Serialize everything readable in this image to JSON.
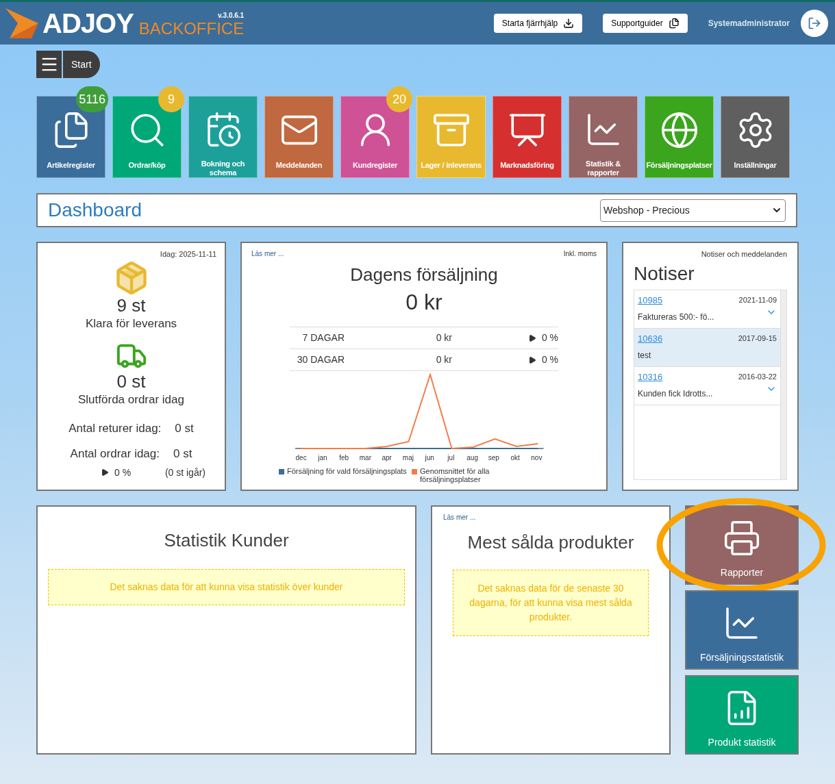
{
  "header": {
    "brand": "ADJOY",
    "product": "BACKOFFICE",
    "version": "v.3.0.6.1",
    "buttons": [
      "Starta fjärrhjälp",
      "Supportguider"
    ],
    "user": "Systemadministrator"
  },
  "nav": {
    "start": "Start"
  },
  "tiles": [
    {
      "label": "Artikelregister",
      "color": "#3a6d9a",
      "badge": {
        "text": "5116",
        "color": "#3f9e3a"
      }
    },
    {
      "label": "Ordrar/köp",
      "color": "#00a878",
      "badge": {
        "text": "9",
        "color": "#e8b92f"
      }
    },
    {
      "label": "Bokning och schema",
      "color": "#1ea09a"
    },
    {
      "label": "Meddelanden",
      "color": "#c0683f"
    },
    {
      "label": "Kundregister",
      "color": "#cf5196",
      "badge": {
        "text": "20",
        "color": "#e8b92f"
      }
    },
    {
      "label": "Lager / inleverans",
      "color": "#e8b92f"
    },
    {
      "label": "Marknadsföring",
      "color": "#d5302f"
    },
    {
      "label": "Statistik & rapporter",
      "color": "#956464"
    },
    {
      "label": "Försäljningsplatser",
      "color": "#3aa51d"
    },
    {
      "label": "Inställningar",
      "color": "#5f5f5f"
    }
  ],
  "dashboard": {
    "title": "Dashboard",
    "shop_select": "Webshop - Precious"
  },
  "orders_card": {
    "date": "Idag: 2025-11-11",
    "ready_count": "9 st",
    "ready_label": "Klara för leverans",
    "done_count": "0 st",
    "done_label": "Slutförda ordrar idag",
    "returns_label": "Antal returer idag:",
    "returns_value": "0 st",
    "orders_label": "Antal ordrar idag:",
    "orders_value": "0 st",
    "change": "0 %",
    "yesterday": "(0 st igår)"
  },
  "sales_card": {
    "link": "Läs mer ...",
    "note": "Inkl. moms",
    "title": "Dagens försäljning",
    "total": "0 kr",
    "rows": [
      {
        "period": "7 DAGAR",
        "amount": "0 kr",
        "change": "0 %"
      },
      {
        "period": "30 DAGAR",
        "amount": "0 kr",
        "change": "0 %"
      }
    ],
    "months": [
      "dec",
      "jan",
      "feb",
      "mar",
      "apr",
      "maj",
      "jun",
      "jul",
      "aug",
      "sep",
      "okt",
      "nov"
    ],
    "legend": [
      {
        "label": "Försäljning för vald försäljningsplats",
        "color": "#3a6d9a"
      },
      {
        "label": "Genomsnittet för alla försäljningsplatser",
        "color": "#f47c48"
      }
    ]
  },
  "notices_card": {
    "caption": "Notiser och meddelanden",
    "title": "Notiser",
    "items": [
      {
        "id": "10985",
        "date": "2021-11-09",
        "text": "Faktureras 500:- fö...",
        "selected": false,
        "expandable": true
      },
      {
        "id": "10636",
        "date": "2017-09-15",
        "text": "test",
        "selected": true,
        "expandable": false
      },
      {
        "id": "10316",
        "date": "2016-03-22",
        "text": "Kunden fick Idrotts...",
        "selected": false,
        "expandable": true
      }
    ]
  },
  "customers_card": {
    "title": "Statistik Kunder",
    "message": "Det saknas data för att kunna visa statistik över kunder"
  },
  "products_card": {
    "link": "Läs mer ...",
    "title": "Mest sålda produkter",
    "message": "Det saknas data för de senaste 30 dagarna, för att kunna visa mest sålda produkter."
  },
  "side_tiles": [
    {
      "label": "Rapporter",
      "color": "#956464",
      "highlighted": true
    },
    {
      "label": "Försäljningsstatistik",
      "color": "#3a6d9a",
      "highlighted": false
    },
    {
      "label": "Produkt statistik",
      "color": "#00a878",
      "highlighted": false
    }
  ]
}
